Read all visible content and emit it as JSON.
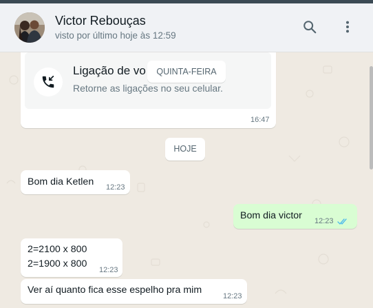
{
  "header": {
    "contact_name": "Victor Rebouças",
    "last_seen": "visto por último hoje às 12:59",
    "search_icon": "search-icon",
    "menu_icon": "more-vertical-icon"
  },
  "call_message": {
    "title": "Ligação de vo",
    "subtitle": "Retorne as ligações no seu celular.",
    "time": "16:47",
    "icon": "missed-call-icon"
  },
  "date_chips": {
    "previous_day": "QUINTA-FEIRA",
    "today": "HOJE"
  },
  "messages": [
    {
      "direction": "in",
      "text": "Bom dia Ketlen",
      "time": "12:23"
    },
    {
      "direction": "out",
      "text": "Bom dia victor",
      "time": "12:23",
      "status": "read"
    },
    {
      "direction": "in",
      "lines": [
        "2=2100 x 800",
        "2=1900 x 800"
      ],
      "time": "12:23"
    },
    {
      "direction": "in",
      "text": "Ver aí quanto fica esse espelho pra mim",
      "time": "12:23"
    }
  ],
  "colors": {
    "chat_background": "#efeae2",
    "incoming_bubble": "#ffffff",
    "outgoing_bubble": "#d9fdd3",
    "read_ticks": "#53bdeb",
    "header_background": "#f0f2f5"
  }
}
